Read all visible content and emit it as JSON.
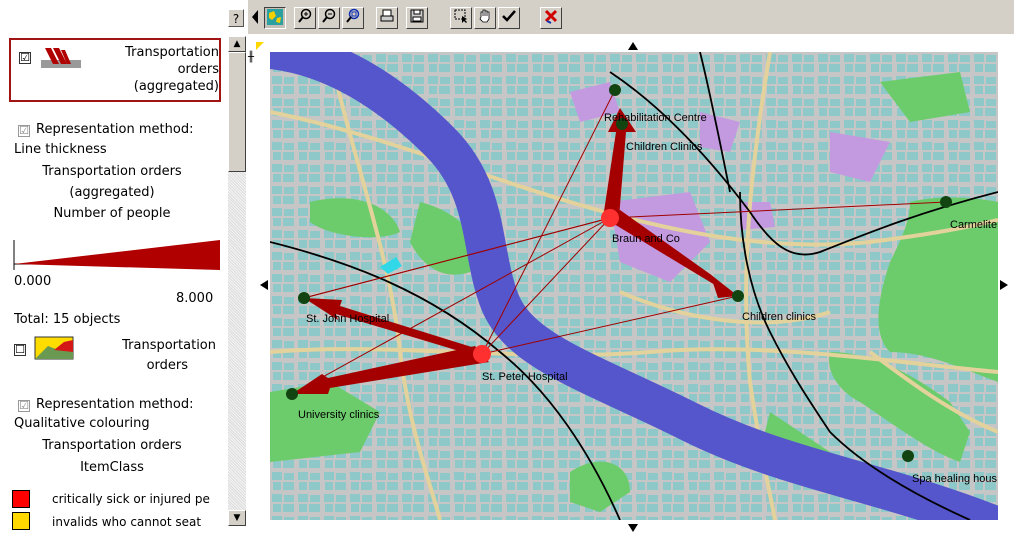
{
  "help_label": "?",
  "legend": {
    "layer1": {
      "checked": "☑",
      "title_lines": [
        "Transportation",
        "orders",
        "(aggregated)"
      ],
      "rep_checked": "☑",
      "rep_lines": [
        "Representation method:",
        "Line thickness"
      ],
      "attr_lines": [
        "Transportation orders",
        "(aggregated)",
        "Number of people"
      ],
      "scale_min": "0.000",
      "scale_max": "8.000",
      "total": "Total: 15 objects"
    },
    "layer2": {
      "checked": "☐",
      "title_lines": [
        "Transportation",
        "orders"
      ],
      "rep_checked": "☑",
      "rep_lines": [
        "Representation method:",
        "Qualitative colouring"
      ],
      "attr_lines": [
        "Transportation orders",
        "ItemClass"
      ],
      "classes": [
        {
          "label": "critically sick or injured pe",
          "color": "#ff0000"
        },
        {
          "label": "invalids who cannot seat",
          "color": "#ffd800"
        }
      ]
    }
  },
  "toolbar": {
    "buttons": [
      "map-view",
      "zoom-in",
      "zoom-out",
      "zoom-fit",
      "print",
      "save",
      "select",
      "pan",
      "confirm",
      "remove-layer"
    ]
  },
  "map": {
    "places": [
      {
        "name": "Rehabilitation Centre"
      },
      {
        "name": "Children Clinics"
      },
      {
        "name": "Braun and Co"
      },
      {
        "name": "Carmelite"
      },
      {
        "name": "Children clinics"
      },
      {
        "name": "St. John Hospital"
      },
      {
        "name": "St. Peter Hospital"
      },
      {
        "name": "University clinics"
      },
      {
        "name": "Spa healing hous"
      }
    ],
    "colors": {
      "flow": "#a00000",
      "node": "#114411",
      "hub": "#ff3030",
      "river": "#5555cc",
      "water_blocks": "#8ec8c8",
      "park": "#6ccc6c",
      "background": "#c8c8c8"
    }
  }
}
